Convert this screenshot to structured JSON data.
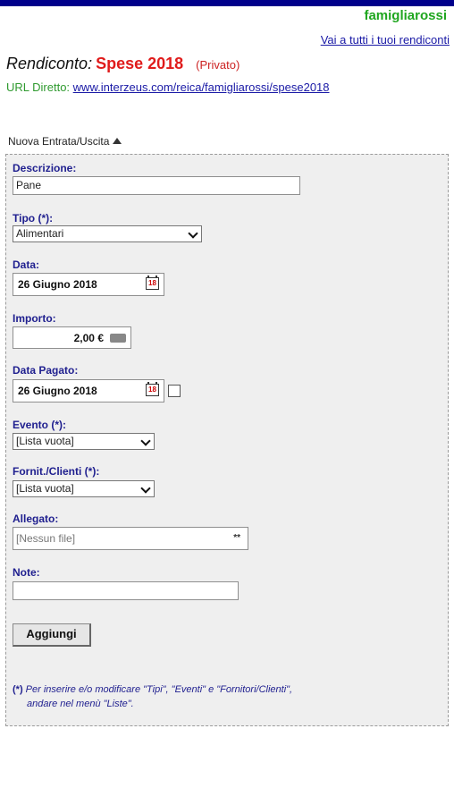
{
  "header": {
    "username": "famigliarossi",
    "all_reports_link": "Vai a tutti i tuoi rendiconti",
    "title_label": "Rendiconto:",
    "report_name": "Spese 2018",
    "visibility": "(Privato)",
    "url_label": "URL Diretto:",
    "url_value": "www.interzeus.com/reica/famigliarossi/spese2018"
  },
  "form": {
    "section_title": "Nuova Entrata/Uscita",
    "descrizione": {
      "label": "Descrizione:",
      "value": "Pane"
    },
    "tipo": {
      "label": "Tipo (*):",
      "selected": "Alimentari"
    },
    "data": {
      "label": "Data:",
      "value": "26 Giugno 2018"
    },
    "importo": {
      "label": "Importo:",
      "value": "2,00 €"
    },
    "data_pagato": {
      "label": "Data Pagato:",
      "value": "26 Giugno 2018"
    },
    "evento": {
      "label": "Evento (*):",
      "selected": "[Lista vuota]"
    },
    "fornitori": {
      "label": "Fornit./Clienti (*):",
      "selected": "[Lista vuota]"
    },
    "allegato": {
      "label": "Allegato:",
      "placeholder": "[Nessun file]",
      "clear_glyph": "**"
    },
    "note": {
      "label": "Note:",
      "value": ""
    },
    "submit_label": "Aggiungi",
    "footnote_marker": "(*)",
    "footnote_line1": "Per inserire e/o modificare \"Tipi\", \"Eventi\" e \"Fornitori/Clienti\",",
    "footnote_line2": "andare nel menù \"Liste\"."
  },
  "icons": {
    "calendar_day": "18",
    "colors": {
      "topbar": "#00008b",
      "username": "#1fa61f",
      "report_name": "#e01b1b",
      "label": "#1f1f8f"
    }
  }
}
